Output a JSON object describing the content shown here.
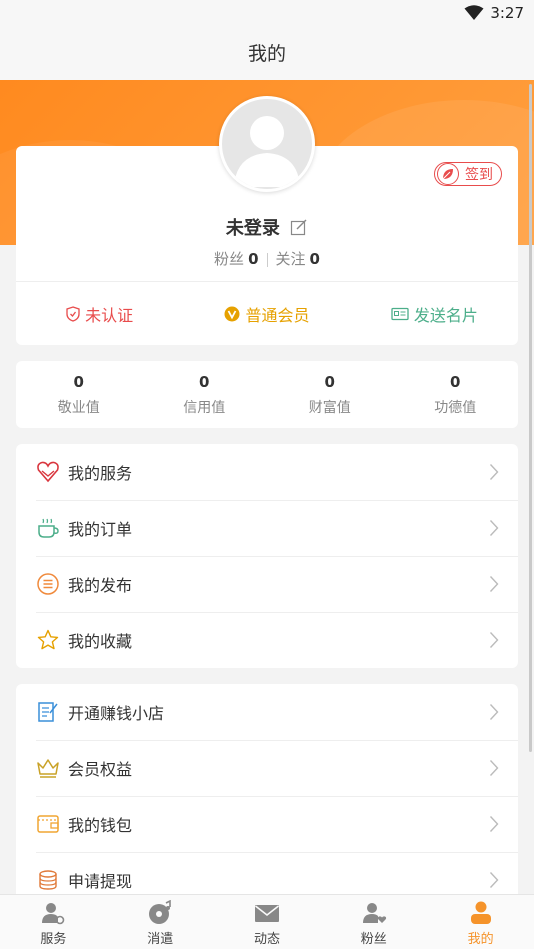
{
  "status": {
    "time": "3:27"
  },
  "header": {
    "title": "我的"
  },
  "profile": {
    "checkin_label": "签到",
    "username": "未登录",
    "fans_label": "粉丝",
    "fans_count": "0",
    "following_label": "关注",
    "following_count": "0",
    "badges": {
      "verify": "未认证",
      "member": "普通会员",
      "card": "发送名片"
    }
  },
  "stats": [
    {
      "value": "0",
      "label": "敬业值"
    },
    {
      "value": "0",
      "label": "信用值"
    },
    {
      "value": "0",
      "label": "财富值"
    },
    {
      "value": "0",
      "label": "功德值"
    }
  ],
  "menu_group1": [
    {
      "label": "我的服务",
      "icon": "heart-hands-icon"
    },
    {
      "label": "我的订单",
      "icon": "cup-icon"
    },
    {
      "label": "我的发布",
      "icon": "list-circle-icon"
    },
    {
      "label": "我的收藏",
      "icon": "star-icon"
    }
  ],
  "menu_group2": [
    {
      "label": "开通赚钱小店",
      "icon": "notepad-icon"
    },
    {
      "label": "会员权益",
      "icon": "crown-icon"
    },
    {
      "label": "我的钱包",
      "icon": "wallet-icon"
    },
    {
      "label": "申请提现",
      "icon": "coins-icon"
    }
  ],
  "tabbar": [
    {
      "label": "服务",
      "icon": "person-gear-icon"
    },
    {
      "label": "消遣",
      "icon": "disc-icon"
    },
    {
      "label": "动态",
      "icon": "mail-icon"
    },
    {
      "label": "粉丝",
      "icon": "person-heart-icon"
    },
    {
      "label": "我的",
      "icon": "person-icon",
      "active": true
    }
  ],
  "colors": {
    "accent": "#f5932a",
    "red": "#e84c4c",
    "gold": "#e6a100",
    "green": "#4cae8a"
  }
}
